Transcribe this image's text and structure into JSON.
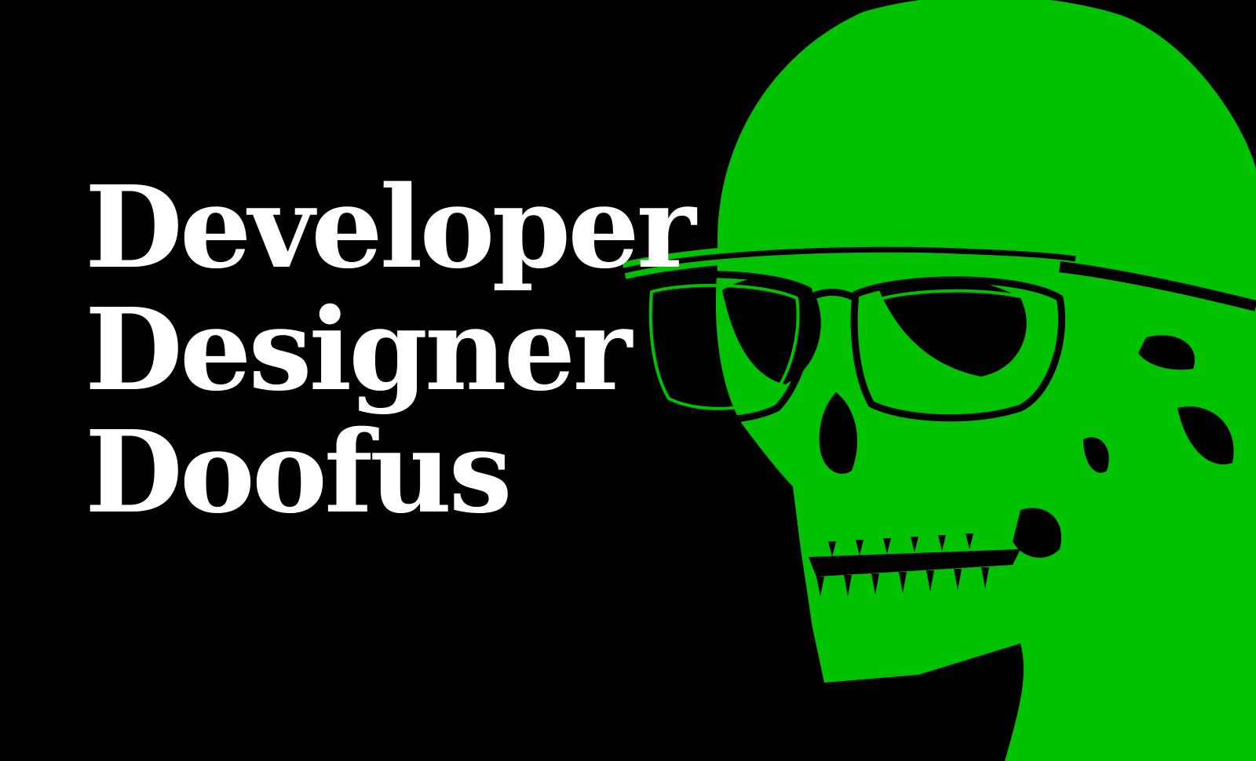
{
  "hero": {
    "lines": [
      "Developer",
      "Designer",
      "Doofus"
    ]
  },
  "illustration": {
    "subject": "skull-with-glasses-icon",
    "fill_color": "#00c200",
    "line_color": "#000000"
  },
  "colors": {
    "background": "#000000",
    "text": "#ffffff",
    "accent": "#00c200"
  }
}
